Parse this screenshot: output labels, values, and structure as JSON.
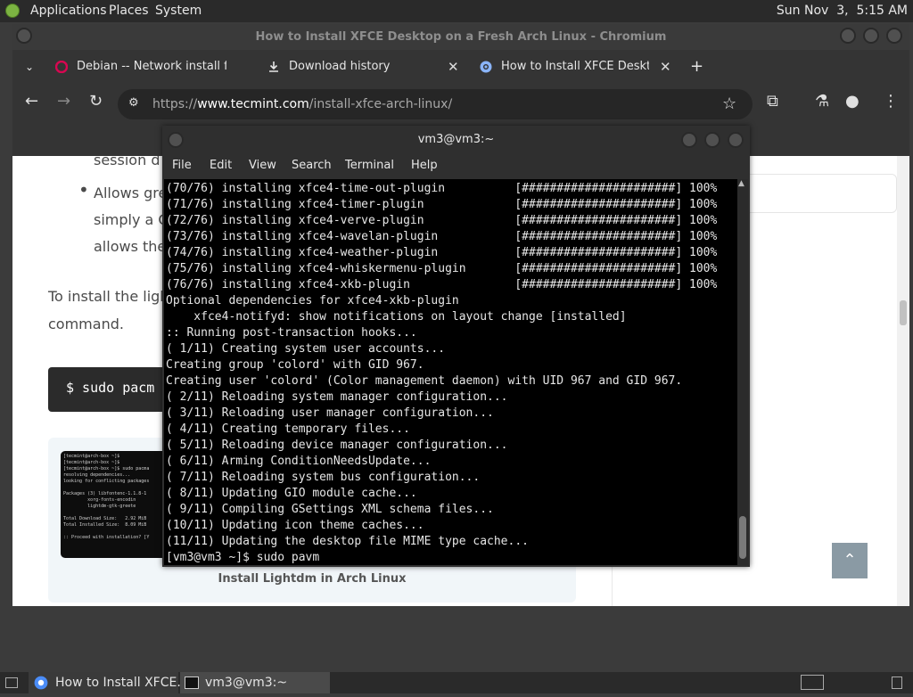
{
  "top_panel": {
    "menus": [
      "Applications",
      "Places",
      "System"
    ],
    "clock": "Sun Nov  3,  5:15 AM"
  },
  "browser": {
    "window_title": "How to Install XFCE Desktop on a Fresh Arch Linux - Chromium",
    "tabs": [
      {
        "label": "Debian -- Network install fro",
        "icon": "debian-icon"
      },
      {
        "label": "Download history",
        "icon": "download-icon"
      },
      {
        "label": "How to Install XFCE Desktop",
        "icon": "chromium-icon"
      }
    ],
    "url": {
      "prefix": "https://",
      "domain": "www.tecmint.com",
      "path": "/install-xfce-arch-linux/"
    }
  },
  "page": {
    "line_session": "session d",
    "bullet_line1": "Allows gre",
    "bullet_line2": "simply a C",
    "bullet_line3": "allows the",
    "para_line1": "To install the ligh",
    "para_line2": "command.",
    "code": "$ sudo pacm",
    "figure_caption": "Install Lightdm in Arch Linux",
    "figure_text": "[tecmint@arch-box ~]$\n[tecmint@arch-box ~]$\n[tecmint@arch-box ~]$ sudo pacma\nresolving dependencies...\nlooking for conflicting packages\n\nPackages (3) libfontenc-1.1.8-1\n         xorg-fonts-encodin\n         lightdm-gtk-greete\n\nTotal Download Size:   2.92 MiB\nTotal Installed Size:  8.09 MiB\n\n:: Proceed with installation? [Y"
  },
  "terminal": {
    "title": "vm3@vm3:~",
    "menus": [
      "File",
      "Edit",
      "View",
      "Search",
      "Terminal",
      "Help"
    ],
    "lines": [
      "(70/76) installing xfce4-time-out-plugin          [######################] 100%",
      "(71/76) installing xfce4-timer-plugin             [######################] 100%",
      "(72/76) installing xfce4-verve-plugin             [######################] 100%",
      "(73/76) installing xfce4-wavelan-plugin           [######################] 100%",
      "(74/76) installing xfce4-weather-plugin           [######################] 100%",
      "(75/76) installing xfce4-whiskermenu-plugin       [######################] 100%",
      "(76/76) installing xfce4-xkb-plugin               [######################] 100%",
      "Optional dependencies for xfce4-xkb-plugin",
      "    xfce4-notifyd: show notifications on layout change [installed]",
      ":: Running post-transaction hooks...",
      "( 1/11) Creating system user accounts...",
      "Creating group 'colord' with GID 967.",
      "Creating user 'colord' (Color management daemon) with UID 967 and GID 967.",
      "( 2/11) Reloading system manager configuration...",
      "( 3/11) Reloading user manager configuration...",
      "( 4/11) Creating temporary files...",
      "( 5/11) Reloading device manager configuration...",
      "( 6/11) Arming ConditionNeedsUpdate...",
      "( 7/11) Reloading system bus configuration...",
      "( 8/11) Updating GIO module cache...",
      "( 9/11) Compiling GSettings XML schema files...",
      "(10/11) Updating icon theme caches...",
      "(11/11) Updating the desktop file MIME type cache...",
      "[vm3@vm3 ~]$ sudo pavm"
    ]
  },
  "taskbar": {
    "tasks": [
      {
        "label": "How to Install XFCE...",
        "icon": "chromium-icon"
      },
      {
        "label": "vm3@vm3:~",
        "icon": "terminal-icon"
      }
    ]
  }
}
